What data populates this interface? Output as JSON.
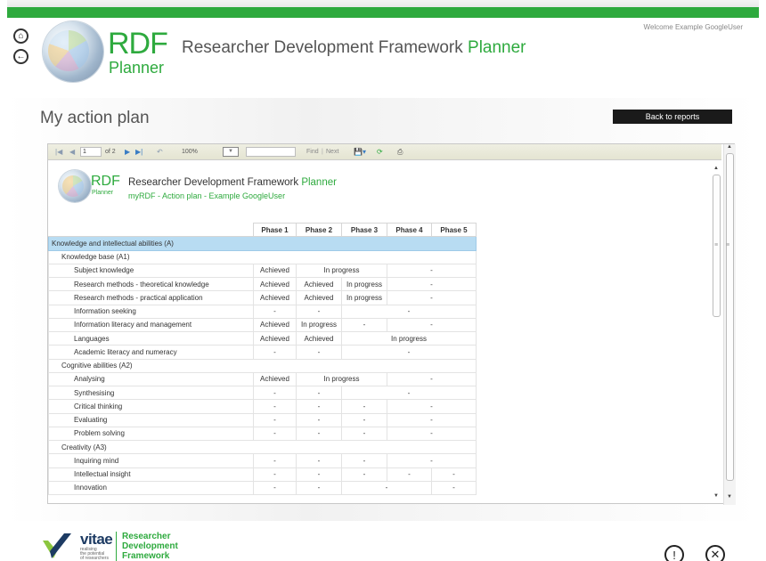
{
  "header": {
    "logo_rdf": "RDF",
    "logo_planner": "Planner",
    "title_main": "Researcher Development Framework",
    "title_accent": "Planner",
    "welcome": "Welcome Example GoogleUser",
    "home_icon": "home-icon",
    "back_icon": "back-arrow-icon"
  },
  "page": {
    "title": "My action plan",
    "back_button": "Back to reports"
  },
  "toolbar": {
    "page_value": "1",
    "page_of": "of 2",
    "zoom": "100%",
    "find_placeholder": "",
    "find_label": "Find",
    "separator": "|",
    "next_label": "Next"
  },
  "report": {
    "logo_rdf": "RDF",
    "logo_planner": "Planner",
    "title_main": "Researcher Development Framework",
    "title_accent": "Planner",
    "subtitle": "myRDF - Action plan - Example GoogleUser"
  },
  "table": {
    "headers": [
      "Phase 1",
      "Phase 2",
      "Phase 3",
      "Phase 4",
      "Phase 5"
    ],
    "category": "Knowledge and intellectual abilities (A)",
    "subsections": [
      {
        "title": "Knowledge base (A1)",
        "rows": [
          {
            "label": "Subject knowledge",
            "cells": [
              "Achieved",
              "In progress",
              "-"
            ]
          },
          {
            "label": "Research methods - theoretical knowledge",
            "cells": [
              "Achieved",
              "Achieved",
              "In progress",
              "-"
            ]
          },
          {
            "label": "Research methods - practical application",
            "cells": [
              "Achieved",
              "Achieved",
              "In progress",
              "-"
            ]
          },
          {
            "label": "Information seeking",
            "cells": [
              "-",
              "-",
              "-"
            ]
          },
          {
            "label": "Information literacy and management",
            "cells": [
              "Achieved",
              "In progress",
              "-",
              "-"
            ]
          },
          {
            "label": "Languages",
            "cells": [
              "Achieved",
              "Achieved",
              "In progress"
            ]
          },
          {
            "label": "Academic literacy and numeracy",
            "cells": [
              "-",
              "-",
              "-"
            ]
          }
        ]
      },
      {
        "title": "Cognitive abilities (A2)",
        "rows": [
          {
            "label": "Analysing",
            "cells": [
              "Achieved",
              "In progress",
              "-"
            ]
          },
          {
            "label": "Synthesising",
            "cells": [
              "-",
              "-",
              "-"
            ]
          },
          {
            "label": "Critical thinking",
            "cells": [
              "-",
              "-",
              "-",
              "-"
            ]
          },
          {
            "label": "Evaluating",
            "cells": [
              "-",
              "-",
              "-",
              "-"
            ]
          },
          {
            "label": "Problem solving",
            "cells": [
              "-",
              "-",
              "-",
              "-"
            ]
          }
        ]
      },
      {
        "title": "Creativity (A3)",
        "rows": [
          {
            "label": "Inquiring mind",
            "cells": [
              "-",
              "-",
              "-",
              "-"
            ]
          },
          {
            "label": "Intellectual insight",
            "cells": [
              "-",
              "-",
              "-",
              "-",
              "-"
            ]
          },
          {
            "label": "Innovation",
            "cells": [
              "-",
              "-",
              "-",
              "-"
            ]
          }
        ]
      }
    ]
  },
  "footer": {
    "vitae": "vitae",
    "vitae_tag_1": "realising",
    "vitae_tag_2": "the potential",
    "vitae_tag_3": "of researchers",
    "rdf_line1": "Researcher",
    "rdf_line2": "Development",
    "rdf_line3": "Framework",
    "info_icon": "info-icon",
    "close_icon": "close-icon"
  }
}
